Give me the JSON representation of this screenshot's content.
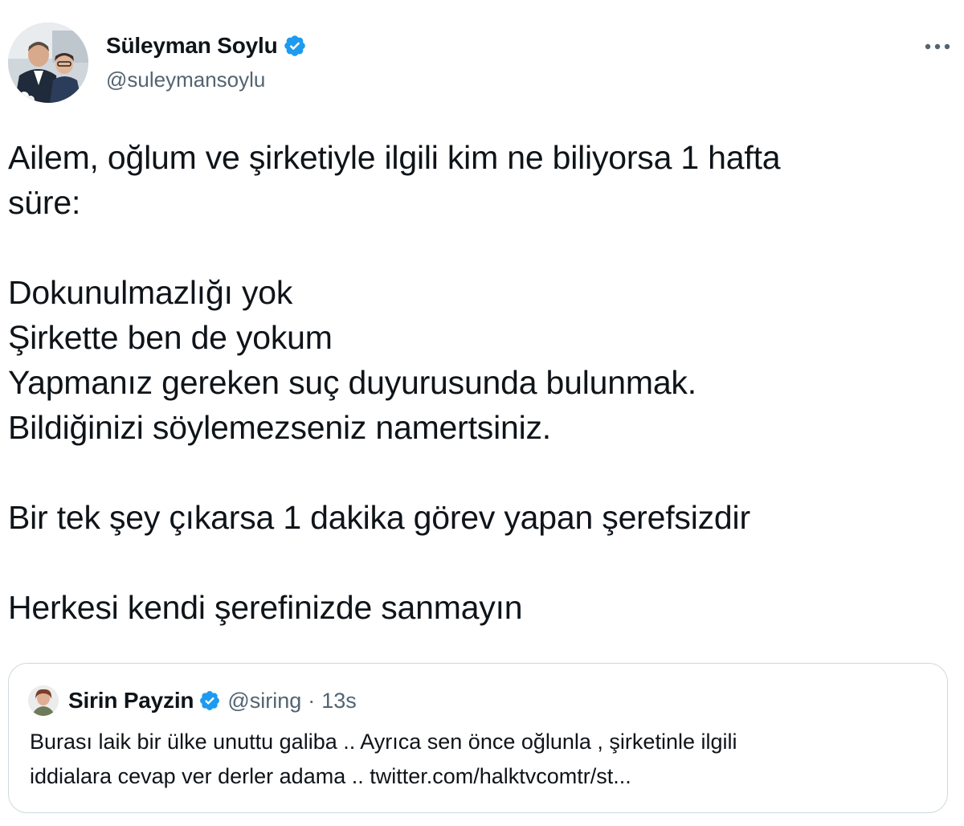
{
  "tweet": {
    "author": {
      "name": "Süleyman Soylu",
      "handle": "@suleymansoylu",
      "verified": true
    },
    "more_icon": "more-horizontal-icon",
    "text_paragraphs": [
      [
        "Ailem, oğlum ve şirketiyle ilgili kim ne biliyorsa 1 hafta",
        "süre:"
      ],
      [
        "Dokunulmazlığı yok",
        "Şirkette ben de yokum",
        "Yapmanız gereken suç duyurusunda bulunmak.",
        "Bildiğinizi söylemezseniz namertsiniz."
      ],
      [
        "Bir tek şey çıkarsa 1 dakika görev yapan şerefsizdir"
      ],
      [
        "Herkesi kendi şerefinizde sanmayın"
      ]
    ]
  },
  "quoted_tweet": {
    "author": {
      "name": "Sirin Payzin",
      "handle": "@siring",
      "verified": true
    },
    "separator": "·",
    "time": "13s",
    "text_lines": [
      "Burası laik bir ülke unuttu galiba .. Ayrıca sen önce oğlunla , şirketinle ilgili",
      "iddialara cevap ver derler adama .. twitter.com/halktvcomtr/st..."
    ]
  },
  "colors": {
    "verified_blue": "#1d9bf0",
    "secondary_text": "#536471",
    "primary_text": "#0f1419",
    "border": "#cfd9de"
  }
}
